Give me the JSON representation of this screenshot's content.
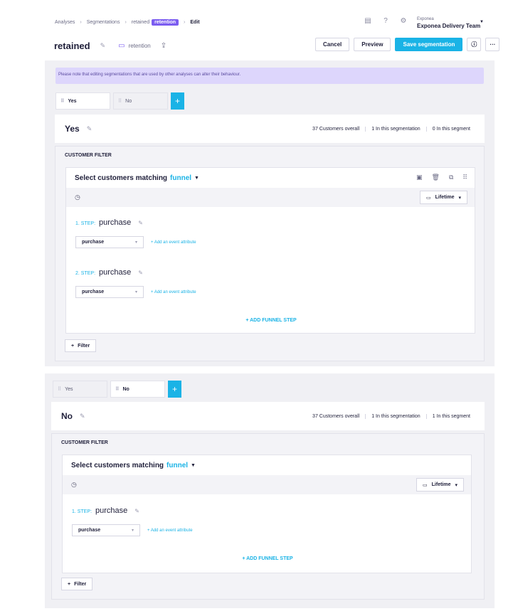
{
  "breadcrumb": [
    "Analyses",
    "Segmentations",
    "retained"
  ],
  "breadcrumb_tag": "retention",
  "breadcrumb_current": "Edit",
  "org": {
    "small": "Exponea",
    "name": "Exponea Delivery Team"
  },
  "title": "retained",
  "folder": "retention",
  "actions": {
    "cancel": "Cancel",
    "preview": "Preview",
    "save": "Save segmentation"
  },
  "notice": "Please note that editing segmentations that are used by other analyses can alter their behaviour.",
  "tabs": [
    "Yes",
    "No"
  ],
  "filter_label": "CUSTOMER FILTER",
  "matching_prefix": "Select customers matching",
  "matching_link": "funnel",
  "lifetime": "Lifetime",
  "add_attr": "+ Add an event attribute",
  "add_step": "+ ADD FUNNEL STEP",
  "filter_button": "Filter",
  "segments": [
    {
      "name": "Yes",
      "stats": {
        "overall": "37 Customers overall",
        "in_segmentation": "1 In this segmentation",
        "in_segment": "0 In this segment"
      },
      "steps": [
        {
          "num": "1. STEP:",
          "event": "purchase",
          "select": "purchase"
        },
        {
          "num": "2. STEP:",
          "event": "purchase",
          "select": "purchase"
        }
      ]
    },
    {
      "name": "No",
      "stats": {
        "overall": "37 Customers overall",
        "in_segmentation": "1 In this segmentation",
        "in_segment": "1 In this segment"
      },
      "steps": [
        {
          "num": "1. STEP:",
          "event": "purchase",
          "select": "purchase"
        }
      ]
    }
  ]
}
